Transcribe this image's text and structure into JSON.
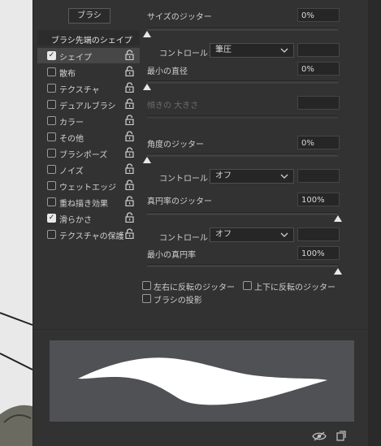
{
  "panel": {
    "brush_button": "ブラシ",
    "section_title": "ブラシ先端のシェイプ"
  },
  "sidebar": {
    "items": [
      {
        "label": "シェイプ",
        "checked": true,
        "selected": true
      },
      {
        "label": "散布",
        "checked": false,
        "selected": false
      },
      {
        "label": "テクスチャ",
        "checked": false,
        "selected": false
      },
      {
        "label": "デュアルブラシ",
        "checked": false,
        "selected": false
      },
      {
        "label": "カラー",
        "checked": false,
        "selected": false
      },
      {
        "label": "その他",
        "checked": false,
        "selected": false
      },
      {
        "label": "ブラシポーズ",
        "checked": false,
        "selected": false
      },
      {
        "label": "ノイズ",
        "checked": false,
        "selected": false
      },
      {
        "label": "ウェットエッジ",
        "checked": false,
        "selected": false
      },
      {
        "label": "重ね描き効果",
        "checked": false,
        "selected": false
      },
      {
        "label": "滑らかさ",
        "checked": true,
        "selected": false
      },
      {
        "label": "テクスチャの保護",
        "checked": false,
        "selected": false
      }
    ]
  },
  "controls": {
    "size_jitter": {
      "label": "サイズのジッター",
      "value": "0%",
      "level": 0
    },
    "size_control": {
      "label": "コントロール：",
      "value": "筆圧"
    },
    "min_diameter": {
      "label": "最小の直径",
      "value": "0%",
      "level": 0
    },
    "tilt_scale": {
      "label": "傾きの 大きさ",
      "value": ""
    },
    "angle_jitter": {
      "label": "角度のジッター",
      "value": "0%",
      "level": 0
    },
    "angle_control": {
      "label": "コントロール：",
      "value": "オフ"
    },
    "roundness_jitter": {
      "label": "真円率のジッター",
      "value": "100%",
      "level": 100
    },
    "roundness_control": {
      "label": "コントロール：",
      "value": "オフ"
    },
    "min_roundness": {
      "label": "最小の真円率",
      "value": "100%",
      "level": 100
    }
  },
  "options": {
    "flip_x": "左右に反転のジッター",
    "flip_y": "上下に反転のジッター",
    "projection": "ブラシの投影"
  },
  "icons": {
    "lock": "lock-icon",
    "check": "✓",
    "footer_left": "eye-visibility-icon",
    "footer_right": "new-preset-icon"
  }
}
